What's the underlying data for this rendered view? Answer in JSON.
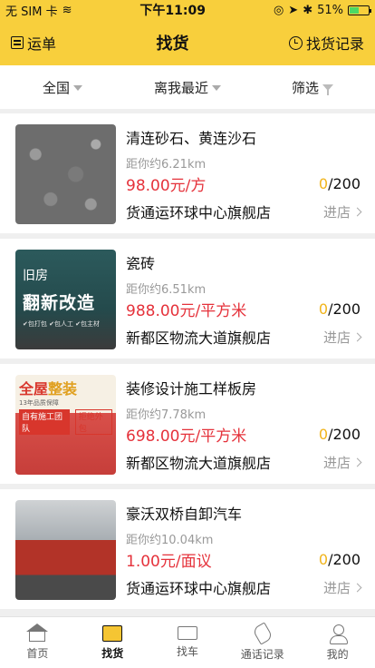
{
  "status_bar": {
    "carrier": "无 SIM 卡",
    "time": "下午11:09",
    "battery": "51%",
    "battery_level": 0.51
  },
  "header": {
    "left_label": "运单",
    "title": "找货",
    "right_label": "找货记录"
  },
  "filters": [
    {
      "label": "全国"
    },
    {
      "label": "离我最近"
    },
    {
      "label": "筛选"
    }
  ],
  "goods": [
    {
      "name": "清连砂石、黄连沙石",
      "distance": "距你约6.21km",
      "price": "98.00元/方",
      "stock_current": "0",
      "stock_total": "/200",
      "shop": "货通运环球中心旗舰店",
      "enter_label": "进店"
    },
    {
      "name": "瓷砖",
      "distance": "距你约6.51km",
      "price": "988.00元/平方米",
      "stock_current": "0",
      "stock_total": "/200",
      "shop": "新都区物流大道旗舰店",
      "enter_label": "进店",
      "image_text": {
        "a": "旧房",
        "b": "翻新改造",
        "c": "✔包打包 ✔包人工 ✔包主材"
      }
    },
    {
      "name": "装修设计施工样板房",
      "distance": "距你约7.78km",
      "price": "698.00元/平方米",
      "stock_current": "0",
      "stock_total": "/200",
      "shop": "新都区物流大道旗舰店",
      "enter_label": "进店",
      "image_text": {
        "a1": "全屋",
        "a2": "整装",
        "c": "13年品质保障",
        "d1": "自有施工团队",
        "d2": "拒绝外包"
      }
    },
    {
      "name": "豪沃双桥自卸汽车",
      "distance": "距你约10.04km",
      "price": "1.00元/面议",
      "stock_current": "0",
      "stock_total": "/200",
      "shop": "货通运环球中心旗舰店",
      "enter_label": "进店"
    }
  ],
  "tabbar": [
    {
      "label": "首页",
      "icon": "home-icon"
    },
    {
      "label": "找货",
      "icon": "box-icon",
      "active": true
    },
    {
      "label": "找车",
      "icon": "truck-icon"
    },
    {
      "label": "通话记录",
      "icon": "phone-icon"
    },
    {
      "label": "我的",
      "icon": "user-icon"
    }
  ]
}
